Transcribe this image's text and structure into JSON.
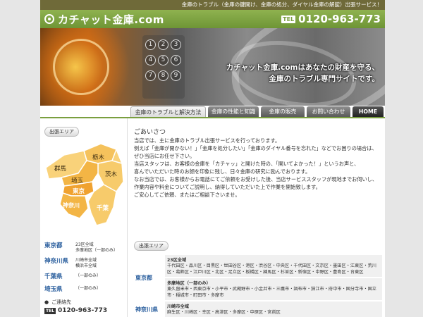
{
  "header": {
    "tagline": "金庫のトラブル（金庫の鍵開け、金庫の処分、ダイヤル金庫の解錠）出張サービス！",
    "logo_text": "カチャット金庫.com",
    "tel_label": "TEL",
    "phone": "0120-963-773"
  },
  "hero": {
    "keys": [
      "1",
      "2",
      "3",
      "4",
      "5",
      "6",
      "7",
      "8",
      "9"
    ],
    "copy_line1": "カチャット金庫.comはあなたの財産を守る、",
    "copy_line2": "金庫のトラブル専門サイトです。"
  },
  "nav": {
    "items": [
      "金庫のトラブルと解決方法",
      "金庫の性能と知識",
      "金庫の販売",
      "お問い合わせ",
      "HOME"
    ]
  },
  "sidebar": {
    "badge": "出張エリア",
    "map_labels": [
      "栃木",
      "群馬",
      "茨木",
      "埼玉",
      "東京",
      "神奈川",
      "千葉"
    ],
    "areas": [
      {
        "name": "東京都",
        "detail": [
          "23区全域",
          "多摩地区（一部のみ）"
        ]
      },
      {
        "name": "神奈川県",
        "detail": [
          "川崎市全域",
          "横浜市全域"
        ]
      },
      {
        "name": "千葉県",
        "detail": [
          "（一部のみ）"
        ]
      },
      {
        "name": "埼玉県",
        "detail": [
          "（一部のみ）"
        ]
      }
    ],
    "contact_label": "ご連絡先",
    "contact_tel_label": "TEL",
    "contact_phone": "0120-963-773"
  },
  "main": {
    "greeting_title": "ごあいさつ",
    "paragraph_lines": [
      "当店では、主に金庫のトラブル出張サービスを行っております。",
      "例えば「金庫が開かない！」「金庫を処分したい」「金庫のダイヤル番号を忘れた」などでお困りの場合は、",
      "ぜひ当店にお任せ下さい。",
      "当店スタッフは、お客様の金庫を「カチャッ」と開けた時の、「開いてよかった！」というお声と、",
      "喜んでいただいた時のお顔を印象に残し、日々金庫の研究に励んでおります。",
      "なお当店では、お客様からお電話にてご依頼をお受けした後、当店サービススタッフが現地までお伺いし、",
      "作業内容や料金についてご説明し、納得していただいた上で作業を開始致します。",
      "ご安心してご依頼、またはご相談下さいませ。"
    ],
    "area_badge": "出張エリア",
    "area_table": [
      {
        "name": "東京都",
        "blocks": [
          {
            "title": "23区全域",
            "list": "千代田区・品川区・目黒区・世田谷区・港区・渋谷区・中央区・千代田区・文京区・墨田区・江東区・荒川区・葛飾区・江戸川区・北区・足立区・板橋区・練馬区・杉並区・新宿区・中野区・豊島区・台東区"
          },
          {
            "title": "多摩地区（一部のみ）",
            "list": "東久留米市・西東京市・小平市・武蔵野市・小金井市・三鷹市・調布市・狛江市・府中市・国分寺市・国立市・稲城市・町田市・多摩市"
          }
        ]
      },
      {
        "name": "神奈川県",
        "blocks": [
          {
            "title": "川崎市全域",
            "list": "麻生区・川崎区・幸区・高津区・多摩区・中原区・宮前区"
          }
        ]
      }
    ]
  }
}
